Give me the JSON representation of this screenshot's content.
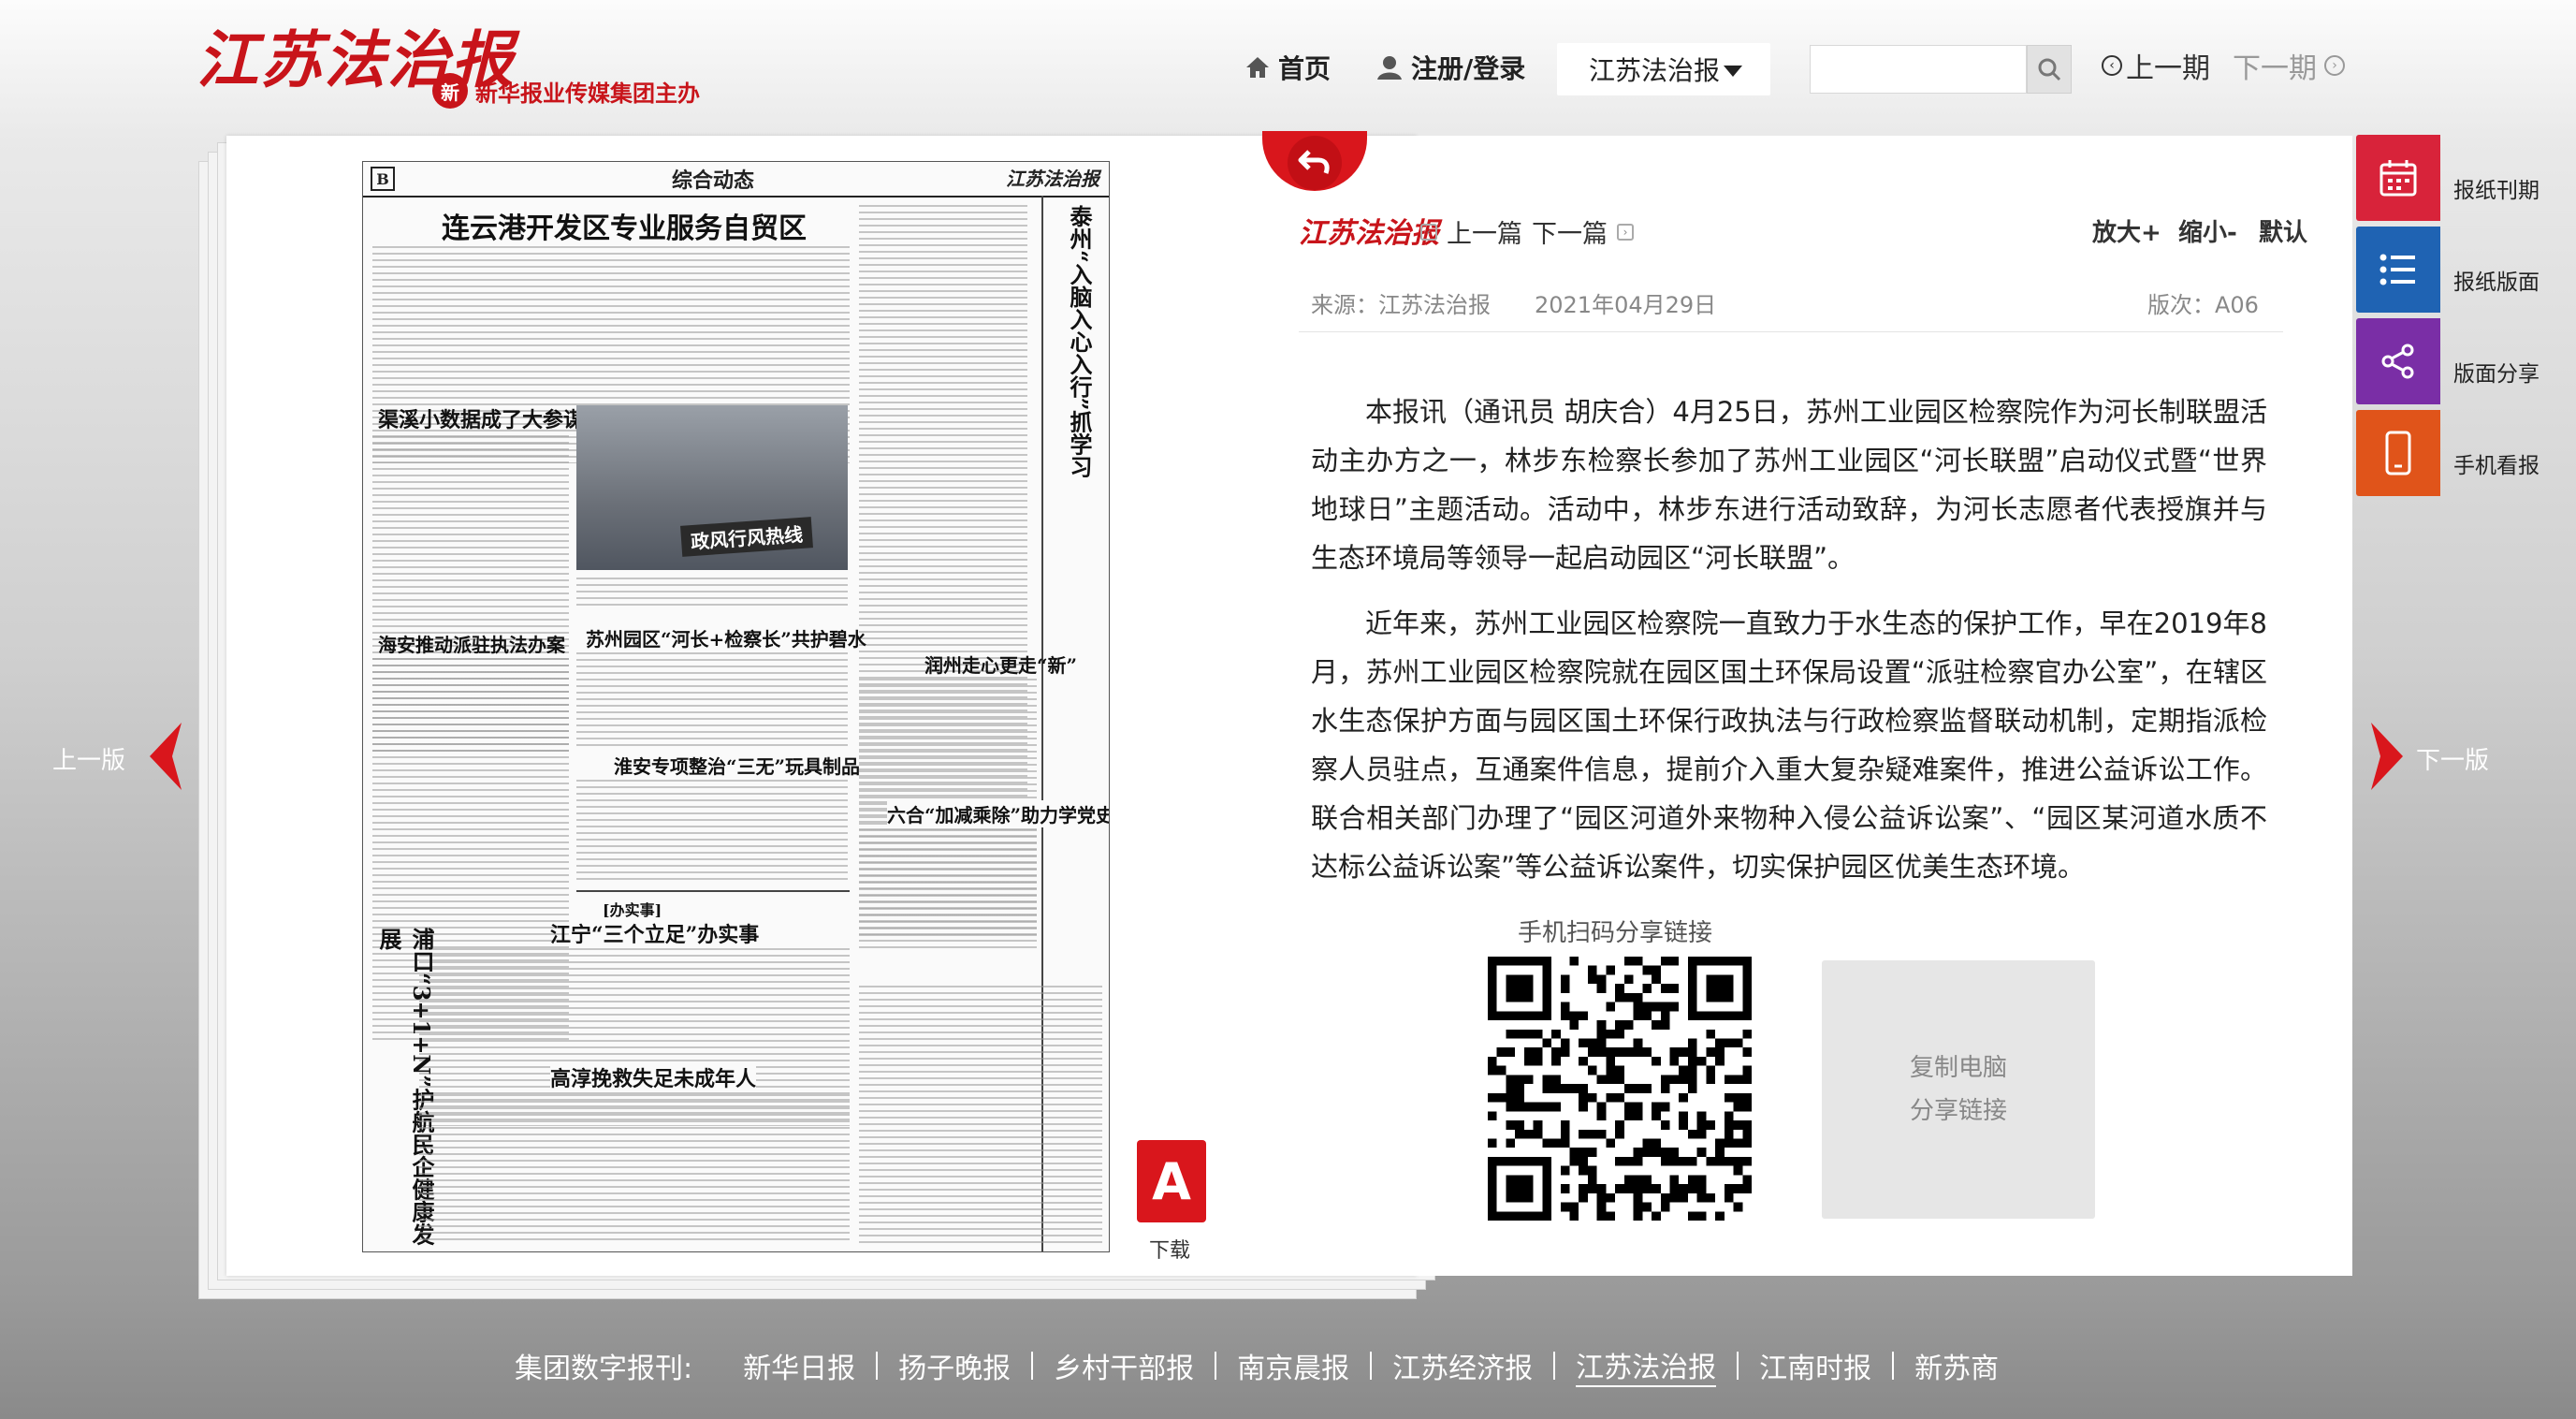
{
  "header": {
    "logo": "江苏法治报",
    "sublogo_mark": "新",
    "sublogo_text": "新华报业传媒集团主办",
    "nav_home": "首页",
    "nav_login": "注册/登录",
    "paper_select": "江苏法治报",
    "search_placeholder": "",
    "prev_issue": "上一期",
    "next_issue": "下一期"
  },
  "newspaper": {
    "page_letter": "B",
    "section": "综合动态",
    "brand": "江苏法治报",
    "headlines": {
      "h1": "连云港开发区专业服务自贸区",
      "h2": "渠溪小数据成了大参谋",
      "h3": "海安推动派驻执法办案",
      "h4": "苏州园区“河长+检察长”共护碧水",
      "h5": "淮安专项整治“三无”玩具制品",
      "h6": "江宁“三个立足”办实事",
      "h7": "高淳挽救失足未成年人",
      "h8": "润州走心更走“新”",
      "h9": "六合“加减乘除”助力学党史",
      "v1": "泰州“入脑入心入行”抓学习",
      "v2": "浦口“3+1+N”护航民企健康发展"
    },
    "photo_banner": "政风行风热线",
    "small_box": "[办实事]"
  },
  "pdf": {
    "icon": "A",
    "label": "下载"
  },
  "article": {
    "logo": "江苏法治报",
    "prev": "上一篇",
    "next": "下一篇",
    "zoom_in": "放大+",
    "zoom_out": "缩小-",
    "zoom_default": "默认",
    "source": "来源：江苏法治报",
    "date": "2021年04月29日",
    "edition": "版次：A06",
    "paragraphs": [
      "本报讯（通讯员 胡庆合）4月25日，苏州工业园区检察院作为河长制联盟活动主办方之一，林步东检察长参加了苏州工业园区“河长联盟”启动仪式暨“世界地球日”主题活动。活动中，林步东进行活动致辞，为河长志愿者代表授旗并与生态环境局等领导一起启动园区“河长联盟”。",
      "近年来，苏州工业园区检察院一直致力于水生态的保护工作，早在2019年8月，苏州工业园区检察院就在园区国土环保局设置“派驻检察官办公室”，在辖区水生态保护方面与园区国土环保行政执法与行政检察监督联动机制，定期指派检察人员驻点，互通案件信息，提前介入重大复杂疑难案件，推进公益诉讼工作。联合相关部门办理了“园区河道外来物种入侵公益诉讼案”、“园区某河道水质不达标公益诉讼案”等公益诉讼案件，切实保护园区优美生态环境。"
    ],
    "qr_caption": "手机扫码分享链接",
    "copy_line1": "复制电脑",
    "copy_line2": "分享链接"
  },
  "side": {
    "prev_page": "上一版",
    "next_page": "下一版"
  },
  "toolbar": {
    "items": [
      {
        "label": "报纸刊期",
        "icon": "calendar-icon",
        "color": "#d8233a"
      },
      {
        "label": "报纸版面",
        "icon": "list-icon",
        "color": "#1f63b3"
      },
      {
        "label": "版面分享",
        "icon": "share-icon",
        "color": "#7a2ea6"
      },
      {
        "label": "手机看报",
        "icon": "phone-icon",
        "color": "#e0541a"
      }
    ]
  },
  "footer": {
    "label": "集团数字报刊:",
    "links": [
      "新华日报",
      "扬子晚报",
      "乡村干部报",
      "南京晨报",
      "江苏经济报",
      "江苏法治报",
      "江南时报",
      "新苏商"
    ]
  },
  "colors": {
    "brand_red": "#c8141a",
    "accent_red": "#d9161c"
  }
}
